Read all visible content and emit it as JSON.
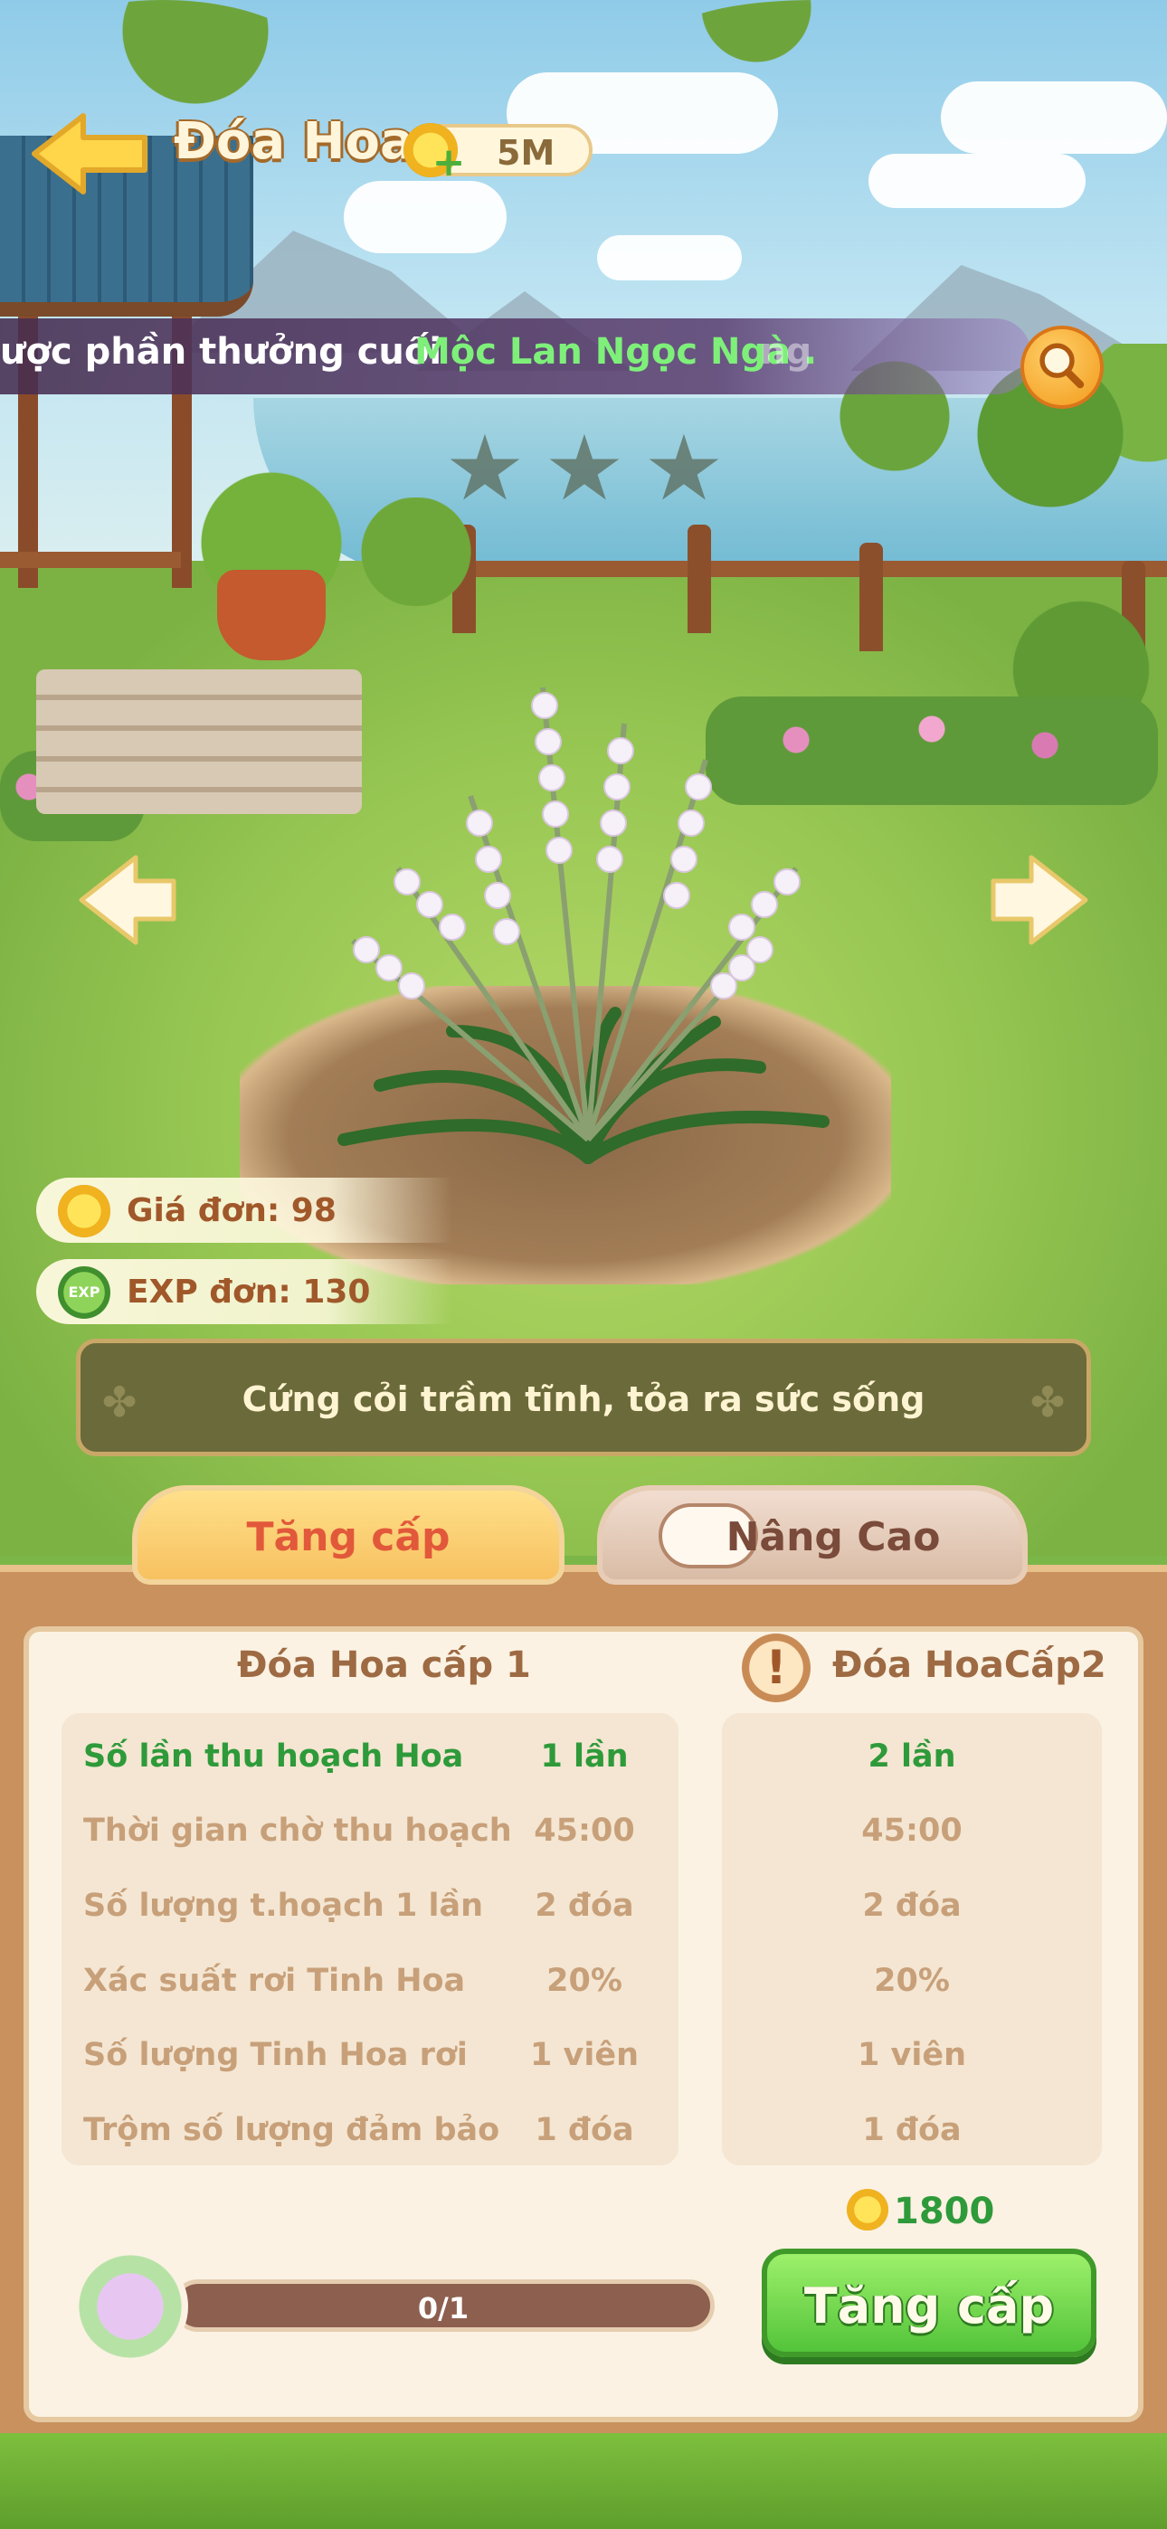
{
  "header": {
    "title": "Đóa Hoa",
    "coin_amount": "5M"
  },
  "marquee": {
    "prefix": "ược phần thưởng cuối",
    "highlight": "Mộc Lan Ngọc Ngà .",
    "suffix": "ng"
  },
  "stars": {
    "filled": 0,
    "total": 3
  },
  "stats": {
    "price_label": "Giá đơn: 98",
    "exp_label": "EXP đơn: 130",
    "exp_icon_text": "EXP"
  },
  "description": "Cứng cỏi trầm tĩnh, tỏa ra sức sống",
  "tabs": [
    {
      "label": "Tăng cấp"
    },
    {
      "label": "Nâng Cao"
    }
  ],
  "current": {
    "title": "Đóa Hoa cấp 1",
    "rows": [
      {
        "label": "Số lần thu hoạch Hoa",
        "value": "1  lần"
      },
      {
        "label": "Thời gian chờ thu hoạch",
        "value": "45:00"
      },
      {
        "label": "Số lượng t.hoạch 1 lần",
        "value": "2  đóa"
      },
      {
        "label": "Xác suất rơi Tinh Hoa",
        "value": "20%"
      },
      {
        "label": "Số lượng Tinh Hoa rơi",
        "value": "1  viên"
      },
      {
        "label": "Trộm số lượng đảm bảo",
        "value": "1  đóa"
      }
    ]
  },
  "next": {
    "title": "Đóa HoaCấp2",
    "values": [
      "2 lần",
      "45:00",
      "2  đóa",
      "20%",
      "1  viên",
      "1  đóa"
    ]
  },
  "cost": "1800",
  "progress": {
    "text": "0/1",
    "fraction": 0
  },
  "upgrade_button": "Tăng cấp",
  "colors": {
    "accent_green": "#2e9a3a",
    "tab_active": "#f7c160",
    "panel": "#fbf2e3"
  }
}
